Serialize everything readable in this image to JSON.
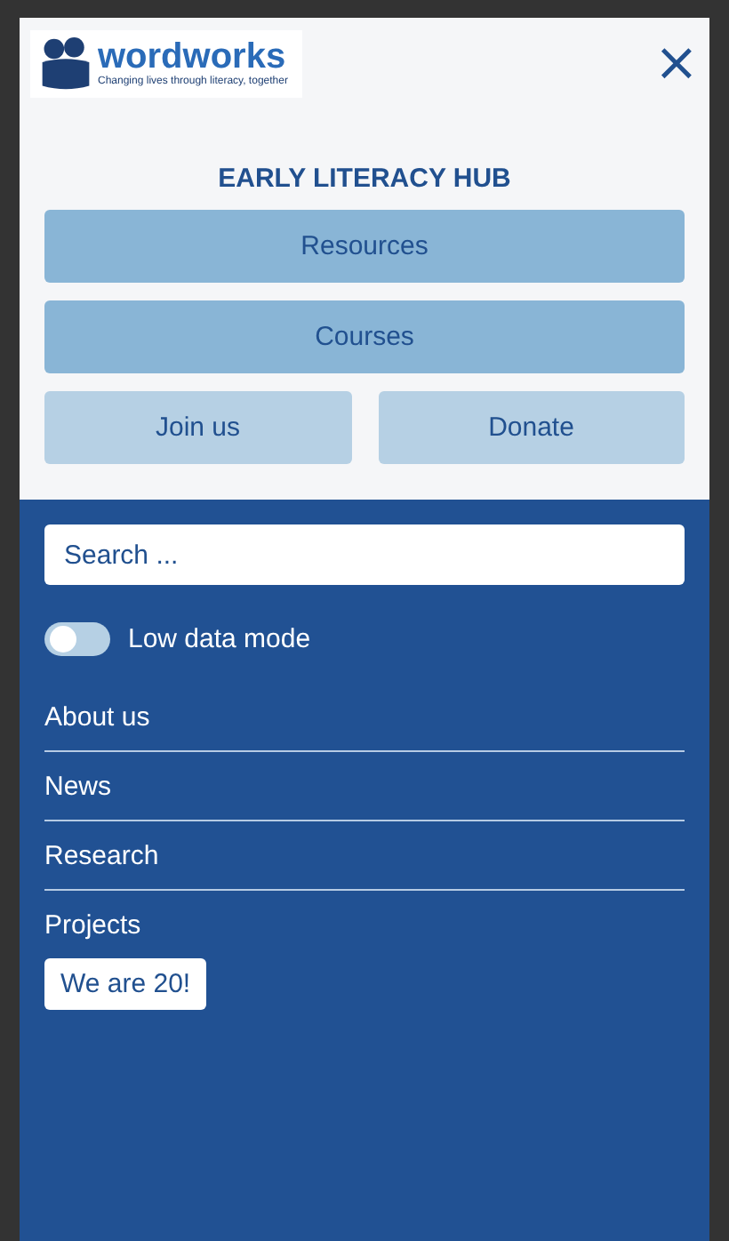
{
  "logo": {
    "name": "wordworks",
    "tagline": "Changing lives through literacy, together"
  },
  "close": "×",
  "hub_title": "EARLY LITERACY HUB",
  "primary_buttons": [
    "Resources",
    "Courses"
  ],
  "secondary_buttons": [
    "Join us",
    "Donate"
  ],
  "search": {
    "placeholder": "Search ..."
  },
  "low_data_mode": {
    "label": "Low data mode",
    "on": false
  },
  "menu": [
    {
      "label": "About us"
    },
    {
      "label": "News"
    },
    {
      "label": "Research"
    },
    {
      "label": "Projects"
    }
  ],
  "badge_button": "We are 20!"
}
